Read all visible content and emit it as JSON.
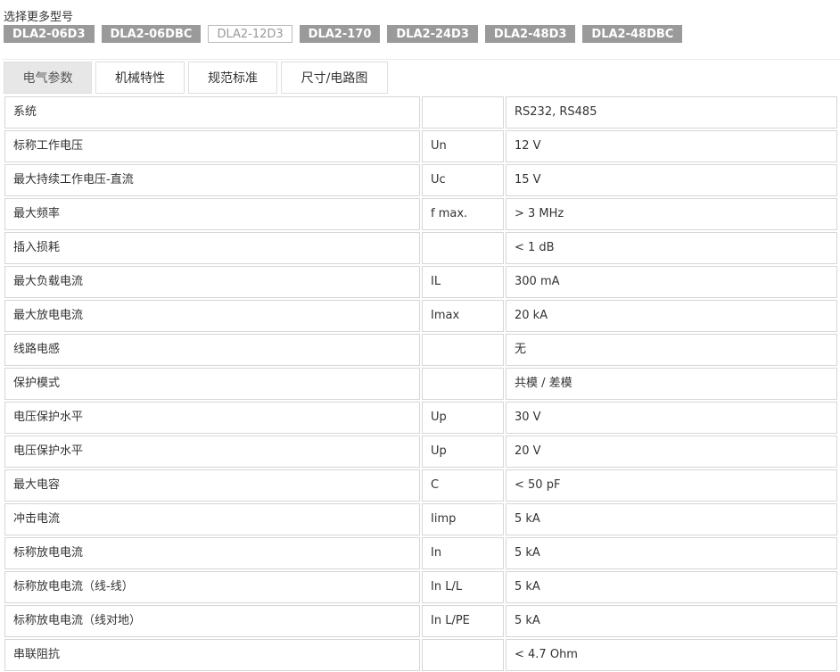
{
  "header": {
    "title": "选择更多型号"
  },
  "models": [
    {
      "label": "DLA2-06D3",
      "active": false
    },
    {
      "label": "DLA2-06DBC",
      "active": false
    },
    {
      "label": "DLA2-12D3",
      "active": true
    },
    {
      "label": "DLA2-170",
      "active": false
    },
    {
      "label": "DLA2-24D3",
      "active": false
    },
    {
      "label": "DLA2-48D3",
      "active": false
    },
    {
      "label": "DLA2-48DBC",
      "active": false
    }
  ],
  "tabs": [
    {
      "label": "电气参数",
      "active": true
    },
    {
      "label": "机械特性",
      "active": false
    },
    {
      "label": "规范标准",
      "active": false
    },
    {
      "label": "尺寸/电路图",
      "active": false
    }
  ],
  "table": {
    "rows": [
      {
        "name": "系统",
        "symbol": "",
        "value": "RS232, RS485"
      },
      {
        "name": "标称工作电压",
        "symbol": "Un",
        "value": "12 V"
      },
      {
        "name": "最大持续工作电压-直流",
        "symbol": "Uc",
        "value": "15 V"
      },
      {
        "name": "最大频率",
        "symbol": "f max.",
        "value": "> 3 MHz"
      },
      {
        "name": "插入损耗",
        "symbol": "",
        "value": "< 1 dB"
      },
      {
        "name": "最大负载电流",
        "symbol": "IL",
        "value": "300 mA"
      },
      {
        "name": "最大放电电流",
        "symbol": "Imax",
        "value": "20 kA"
      },
      {
        "name": "线路电感",
        "symbol": "",
        "value": "无"
      },
      {
        "name": "保护模式",
        "symbol": "",
        "value": "共模 / 差模"
      },
      {
        "name": "电压保护水平",
        "symbol": "Up",
        "value": "30 V"
      },
      {
        "name": "电压保护水平",
        "symbol": "Up",
        "value": "20 V"
      },
      {
        "name": "最大电容",
        "symbol": "C",
        "value": "< 50 pF"
      },
      {
        "name": "冲击电流",
        "symbol": "Iimp",
        "value": "5 kA"
      },
      {
        "name": "标称放电电流",
        "symbol": "In",
        "value": "5 kA"
      },
      {
        "name": "标称放电电流（线-线）",
        "symbol": "In L/L",
        "value": "5 kA"
      },
      {
        "name": "标称放电电流（线对地）",
        "symbol": "In L/PE",
        "value": "5 kA"
      },
      {
        "name": "串联阻抗",
        "symbol": "",
        "value": "< 4.7 Ohm"
      }
    ]
  }
}
